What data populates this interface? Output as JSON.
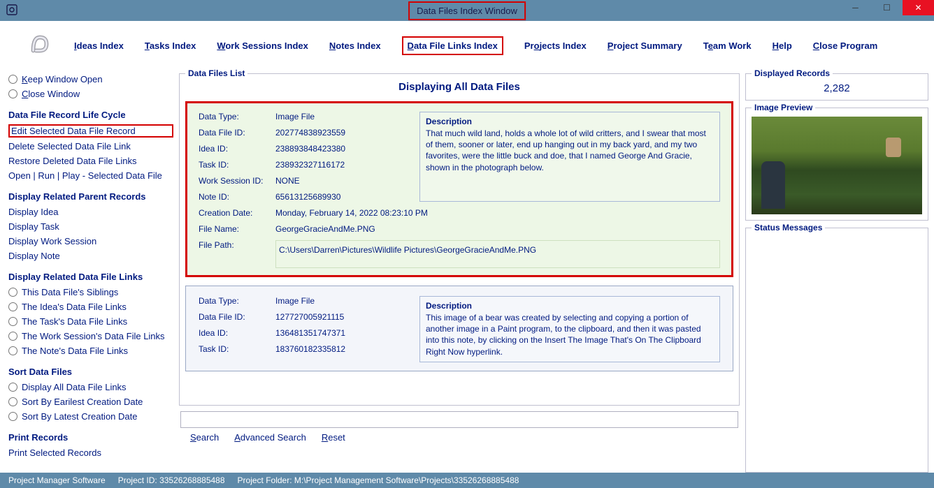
{
  "window": {
    "title": "Data Files Index Window"
  },
  "menubar": {
    "ideas": "Ideas Index",
    "tasks": "Tasks Index",
    "work_sessions": "Work Sessions Index",
    "notes": "Notes Index",
    "data_file_links": "Data File Links Index",
    "projects": "Projects Index",
    "project_summary": "Project Summary",
    "team_work": "Team Work",
    "help": "Help",
    "close_program": "Close Program"
  },
  "sidebar": {
    "keep_open": "Keep Window Open",
    "close_window": "Close Window",
    "grp_lifecycle": "Data File Record Life Cycle",
    "edit_selected": "Edit Selected Data File Record",
    "delete_selected": "Delete Selected Data File Link",
    "restore_deleted": "Restore Deleted Data File Links",
    "open_run_play": "Open | Run | Play - Selected Data File",
    "grp_display_parent": "Display Related Parent Records",
    "display_idea": "Display Idea",
    "display_task": "Display Task",
    "display_work_session": "Display Work Session",
    "display_note": "Display Note",
    "grp_related_links": "Display Related Data File Links",
    "this_siblings": "This Data File's Siblings",
    "ideas_links": "The Idea's Data File Links",
    "tasks_links": "The Task's Data File Links",
    "ws_links": "The Work Session's Data File Links",
    "notes_links": "The Note's Data File Links",
    "grp_sort": "Sort Data Files",
    "display_all": "Display All Data File Links",
    "sort_earliest": "Sort By Earilest Creation Date",
    "sort_latest": "Sort By Latest Creation Date",
    "grp_print": "Print Records",
    "print_selected": "Print Selected Records"
  },
  "list": {
    "legend": "Data Files List",
    "heading": "Displaying All Data Files"
  },
  "record1": {
    "labels": {
      "data_type": "Data Type:",
      "data_file_id": "Data File ID:",
      "idea_id": "Idea ID:",
      "task_id": "Task ID:",
      "work_session_id": "Work Session ID:",
      "note_id": "Note ID:",
      "creation_date": "Creation Date:",
      "file_name": "File Name:",
      "file_path": "File Path:"
    },
    "data_type": "Image File",
    "data_file_id": "202774838923559",
    "idea_id": "238893848423380",
    "task_id": "238932327116172",
    "work_session_id": "NONE",
    "note_id": "65613125689930",
    "creation_date": "Monday, February 14, 2022   08:23:10 PM",
    "file_name": "GeorgeGracieAndMe.PNG",
    "file_path": "C:\\Users\\Darren\\Pictures\\Wildlife Pictures\\GeorgeGracieAndMe.PNG",
    "desc_label": "Description",
    "description": "That much wild land, holds a whole lot of wild critters, and I swear that most of them, sooner or later, end up hanging out in my back yard, and my two favorites, were the little buck and doe, that I named George And Gracie, shown in the photograph below."
  },
  "record2": {
    "labels": {
      "data_type": "Data Type:",
      "data_file_id": "Data File ID:",
      "idea_id": "Idea ID:",
      "task_id": "Task ID:"
    },
    "data_type": "Image File",
    "data_file_id": "127727005921115",
    "idea_id": "136481351747371",
    "task_id": "183760182335812",
    "desc_label": "Description",
    "description": "This image of a bear was created by selecting and copying a portion of another image in a Paint program, to the clipboard, and then it was pasted into this note, by clicking on the Insert The Image That's On The Clipboard Right Now hyperlink."
  },
  "search": {
    "search": "Search",
    "advanced": "Advanced Search",
    "reset": "Reset",
    "placeholder": ""
  },
  "right": {
    "displayed_legend": "Displayed Records",
    "displayed_count": "2,282",
    "preview_legend": "Image Preview",
    "status_legend": "Status Messages"
  },
  "statusbar": {
    "app": "Project Manager Software",
    "project_id": "Project ID:  33526268885488",
    "project_folder": "Project Folder:  M:\\Project Management Software\\Projects\\33526268885488"
  }
}
